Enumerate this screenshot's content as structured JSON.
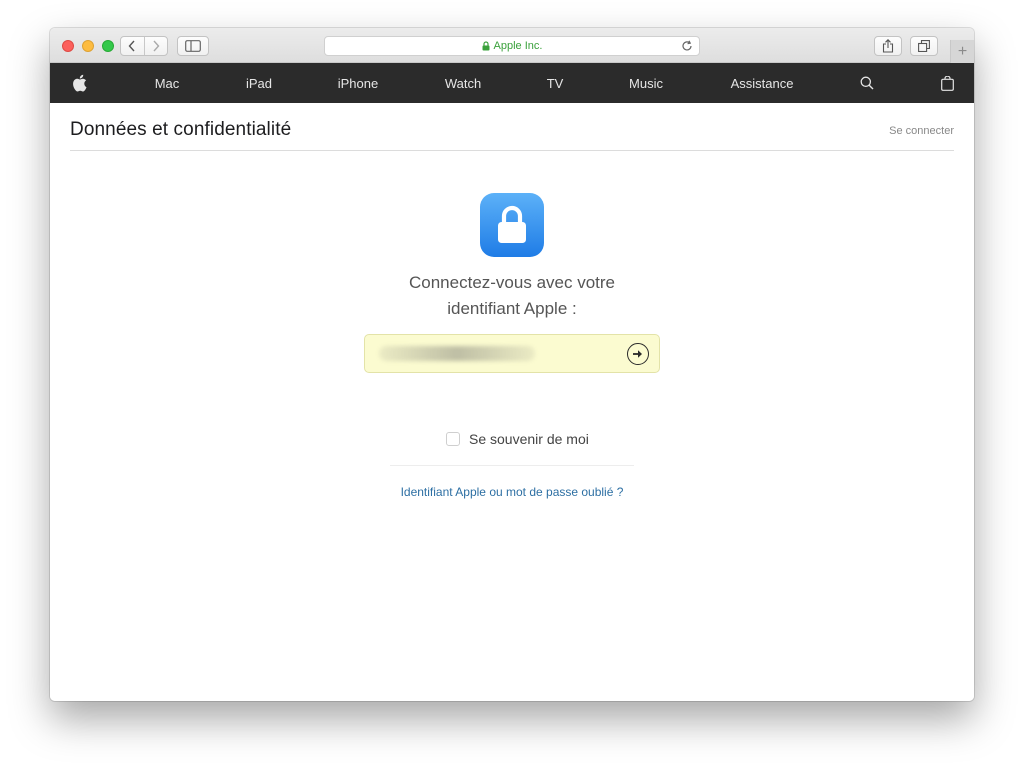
{
  "browser": {
    "address_text": "Apple Inc."
  },
  "globalnav": {
    "items": [
      {
        "label": "Mac"
      },
      {
        "label": "iPad"
      },
      {
        "label": "iPhone"
      },
      {
        "label": "Watch"
      },
      {
        "label": "TV"
      },
      {
        "label": "Music"
      },
      {
        "label": "Assistance"
      }
    ]
  },
  "page": {
    "title": "Données et confidentialité",
    "signin_link": "Se connecter"
  },
  "login": {
    "prompt_line1": "Connectez-vous avec votre",
    "prompt_line2": "identifiant Apple :",
    "remember_label": "Se souvenir de moi",
    "forgot_link": "Identifiant Apple ou mot de passe oublié ?"
  },
  "colors": {
    "nav_background": "#2b2b2b",
    "lock_tile": "#1f7ce6",
    "field_autofill": "#fbfbd0",
    "link": "#2d6fa3",
    "secure_green": "#3aa13b"
  },
  "icons": [
    "apple-logo-icon",
    "search-icon",
    "bag-icon",
    "lock-icon",
    "arrow-right-icon",
    "reload-icon",
    "share-icon",
    "tabs-icon",
    "sidebar-icon"
  ]
}
